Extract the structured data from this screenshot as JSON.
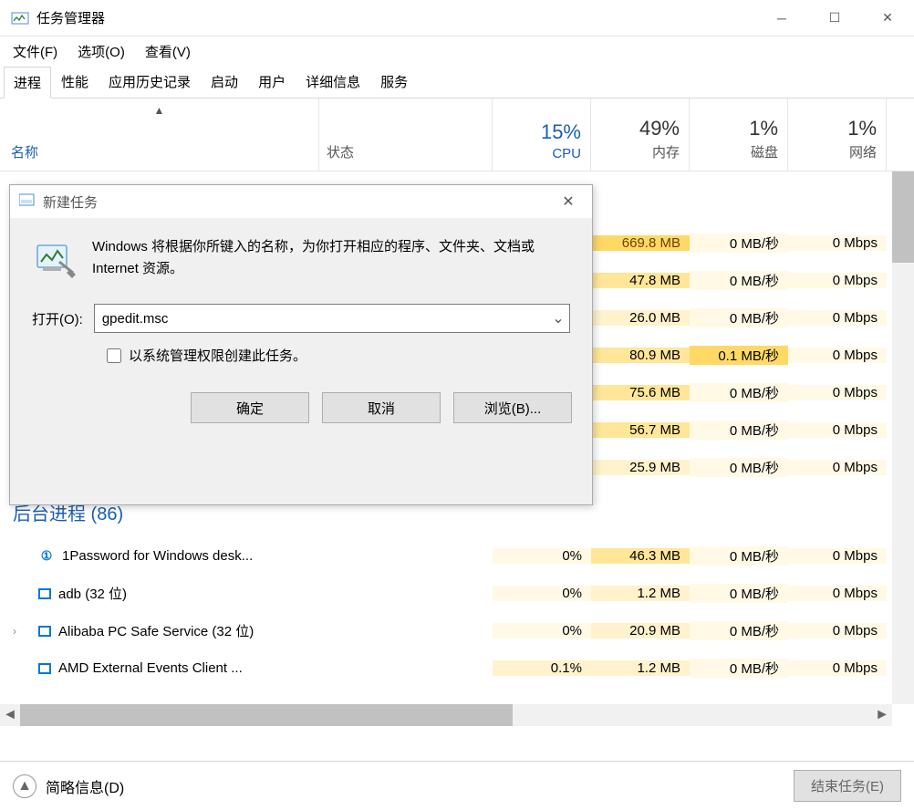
{
  "titlebar": {
    "title": "任务管理器"
  },
  "menu": {
    "file": "文件(F)",
    "options": "选项(O)",
    "view": "查看(V)"
  },
  "tabs": {
    "processes": "进程",
    "performance": "性能",
    "history": "应用历史记录",
    "startup": "启动",
    "users": "用户",
    "details": "详细信息",
    "services": "服务"
  },
  "columns": {
    "name": "名称",
    "status": "状态",
    "cpu": {
      "pct": "15%",
      "label": "CPU"
    },
    "memory": {
      "pct": "49%",
      "label": "内存"
    },
    "disk": {
      "pct": "1%",
      "label": "磁盘"
    },
    "network": {
      "pct": "1%",
      "label": "网络"
    }
  },
  "visible_rows": [
    {
      "type": "data",
      "memory": "669.8 MB",
      "disk": "0 MB/秒",
      "network": "0 Mbps",
      "mem_heat": "heat3"
    },
    {
      "type": "data",
      "memory": "47.8 MB",
      "disk": "0 MB/秒",
      "network": "0 Mbps",
      "mem_heat": "heat2"
    },
    {
      "type": "data",
      "memory": "26.0 MB",
      "disk": "0 MB/秒",
      "network": "0 Mbps",
      "mem_heat": "heat1"
    },
    {
      "type": "data",
      "memory": "80.9 MB",
      "disk": "0.1 MB/秒",
      "network": "0 Mbps",
      "mem_heat": "heat2",
      "disk_heat": "heat-highlight"
    },
    {
      "type": "data",
      "memory": "75.6 MB",
      "disk": "0 MB/秒",
      "network": "0 Mbps",
      "mem_heat": "heat2"
    },
    {
      "type": "data",
      "memory": "56.7 MB",
      "disk": "0 MB/秒",
      "network": "0 Mbps",
      "mem_heat": "heat2"
    },
    {
      "type": "data",
      "memory": "25.9 MB",
      "disk": "0 MB/秒",
      "network": "0 Mbps",
      "mem_heat": "heat1"
    }
  ],
  "group": {
    "label": "后台进程 (86)"
  },
  "procs": [
    {
      "name": "1Password for Windows desk...",
      "cpu": "0%",
      "memory": "46.3 MB",
      "disk": "0 MB/秒",
      "network": "0 Mbps",
      "icon": "circle",
      "mem_heat": "heat2"
    },
    {
      "name": "adb (32 位)",
      "cpu": "0%",
      "memory": "1.2 MB",
      "disk": "0 MB/秒",
      "network": "0 Mbps",
      "icon": "rect",
      "mem_heat": "heat1"
    },
    {
      "name": "Alibaba PC Safe Service (32 位)",
      "cpu": "0%",
      "memory": "20.9 MB",
      "disk": "0 MB/秒",
      "network": "0 Mbps",
      "icon": "rect",
      "mem_heat": "heat1",
      "expand": true
    },
    {
      "name": "AMD External Events Client ...",
      "cpu": "0.1%",
      "memory": "1.2 MB",
      "disk": "0 MB/秒",
      "network": "0 Mbps",
      "icon": "rect",
      "mem_heat": "heat1",
      "cpu_heat": "heat1"
    }
  ],
  "footer": {
    "brief": "简略信息(D)",
    "end_task": "结束任务(E)"
  },
  "dialog": {
    "title": "新建任务",
    "message": "Windows 将根据你所键入的名称，为你打开相应的程序、文件夹、文档或 Internet 资源。",
    "open_label": "打开(O):",
    "input_value": "gpedit.msc",
    "checkbox_label": "以系统管理权限创建此任务。",
    "ok": "确定",
    "cancel": "取消",
    "browse": "浏览(B)..."
  }
}
